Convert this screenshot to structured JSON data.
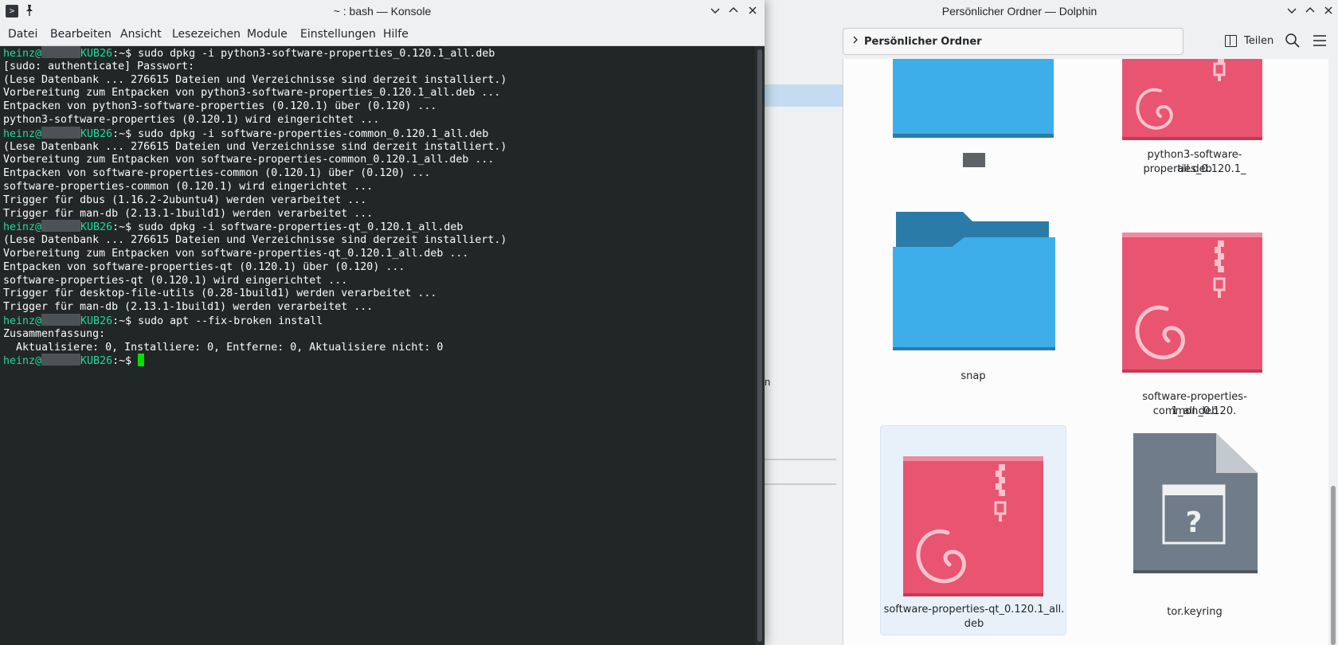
{
  "dolphin": {
    "title": "Persönlicher Ordner — Dolphin",
    "breadcrumb": "Persönlicher Ordner",
    "split_label": "Teilen",
    "places_partial_text": "n",
    "items": [
      {
        "label": ""
      },
      {
        "label": "python3-software-properties_0.120.1_all.deb",
        "line1": "python3-software-properties_0.120.1_",
        "line2": "all.deb"
      },
      {
        "label": "snap"
      },
      {
        "label": "software-properties-common_0.120.1_all.deb",
        "line1": "software-properties-common_0.120.",
        "line2": "1_all.deb"
      },
      {
        "label": "software-properties-qt_0.120.1_all.deb",
        "line1": "software-properties-qt_0.120.1_all.",
        "line2": "deb"
      },
      {
        "label": "tor.keyring"
      }
    ],
    "colors": {
      "folder": "#3daee9",
      "folder_dark": "#2a7ba8",
      "deb": "#e95470",
      "keyring": "#707c89",
      "selection": "#c3dcf1"
    }
  },
  "konsole": {
    "title": "~ : bash — Konsole",
    "menu": [
      "Datei",
      "Bearbeiten",
      "Ansicht",
      "Lesezeichen",
      "Module",
      "Einstellungen",
      "Hilfe"
    ],
    "prompt": {
      "user": "heinz@",
      "host": "KUB26",
      "sym": ":~$ "
    },
    "lines": [
      {
        "prompt": true,
        "text": "sudo dpkg -i python3-software-properties_0.120.1_all.deb"
      },
      {
        "prompt": false,
        "text": "[sudo: authenticate] Passwort:"
      },
      {
        "prompt": false,
        "text": "(Lese Datenbank ... 276615 Dateien und Verzeichnisse sind derzeit installiert.)"
      },
      {
        "prompt": false,
        "text": "Vorbereitung zum Entpacken von python3-software-properties_0.120.1_all.deb ..."
      },
      {
        "prompt": false,
        "text": "Entpacken von python3-software-properties (0.120.1) über (0.120) ..."
      },
      {
        "prompt": false,
        "text": "python3-software-properties (0.120.1) wird eingerichtet ..."
      },
      {
        "prompt": true,
        "text": "sudo dpkg -i software-properties-common_0.120.1_all.deb"
      },
      {
        "prompt": false,
        "text": "(Lese Datenbank ... 276615 Dateien und Verzeichnisse sind derzeit installiert.)"
      },
      {
        "prompt": false,
        "text": "Vorbereitung zum Entpacken von software-properties-common_0.120.1_all.deb ..."
      },
      {
        "prompt": false,
        "text": "Entpacken von software-properties-common (0.120.1) über (0.120) ..."
      },
      {
        "prompt": false,
        "text": "software-properties-common (0.120.1) wird eingerichtet ..."
      },
      {
        "prompt": false,
        "text": "Trigger für dbus (1.16.2-2ubuntu4) werden verarbeitet ..."
      },
      {
        "prompt": false,
        "text": "Trigger für man-db (2.13.1-1build1) werden verarbeitet ..."
      },
      {
        "prompt": true,
        "text": "sudo dpkg -i software-properties-qt_0.120.1_all.deb"
      },
      {
        "prompt": false,
        "text": "(Lese Datenbank ... 276615 Dateien und Verzeichnisse sind derzeit installiert.)"
      },
      {
        "prompt": false,
        "text": "Vorbereitung zum Entpacken von software-properties-qt_0.120.1_all.deb ..."
      },
      {
        "prompt": false,
        "text": "Entpacken von software-properties-qt (0.120.1) über (0.120) ..."
      },
      {
        "prompt": false,
        "text": "software-properties-qt (0.120.1) wird eingerichtet ..."
      },
      {
        "prompt": false,
        "text": "Trigger für desktop-file-utils (0.28-1build1) werden verarbeitet ..."
      },
      {
        "prompt": false,
        "text": "Trigger für man-db (2.13.1-1build1) werden verarbeitet ..."
      },
      {
        "prompt": true,
        "text": "sudo apt --fix-broken install"
      },
      {
        "prompt": false,
        "text": "Zusammenfassung:"
      },
      {
        "prompt": false,
        "text": "  Aktualisiere: 0, Installiere: 0, Entferne: 0, Aktualisiere nicht: 0"
      },
      {
        "prompt": true,
        "text": "",
        "cursor": true
      }
    ],
    "colors": {
      "background": "#232627",
      "foreground": "#fcfcfc",
      "prompt": "#1cdc9a",
      "cursor": "#00e000"
    }
  }
}
